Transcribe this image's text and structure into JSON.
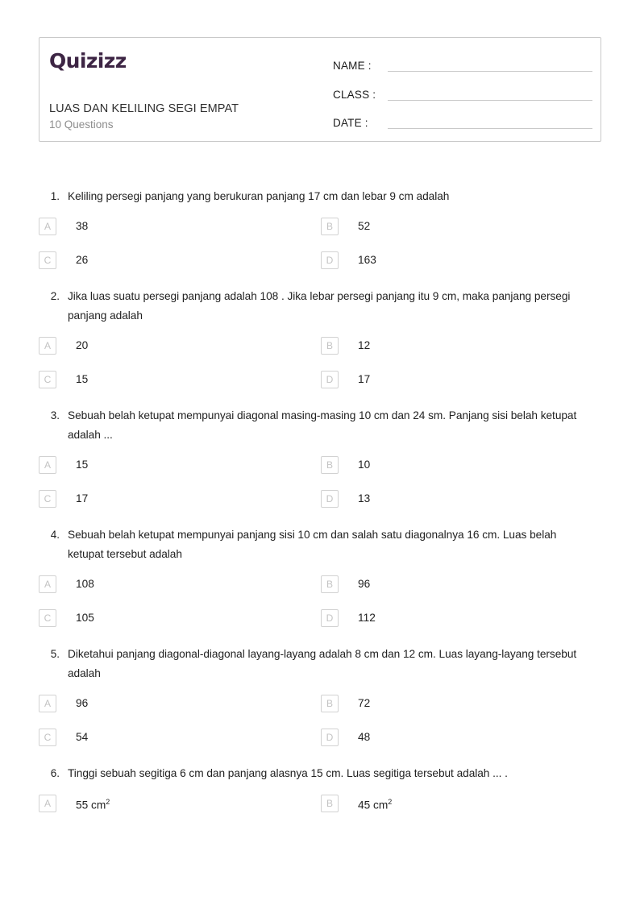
{
  "header": {
    "brand": "Quizizz",
    "title": "LUAS DAN KELILING SEGI EMPAT",
    "question_count": "10 Questions",
    "fields": [
      {
        "label": "NAME :",
        "value": ""
      },
      {
        "label": "CLASS :",
        "value": ""
      },
      {
        "label": "DATE  :",
        "value": ""
      }
    ]
  },
  "colors": {
    "brand_purple": "#3d2544",
    "card_border": "#c9c9c9",
    "option_box_border": "#d2d2d2",
    "option_letter": "#c3c3c3",
    "text": "#222222",
    "muted_text": "#8d8d8d"
  },
  "questions": [
    {
      "number": "1.",
      "text": "Keliling persegi panjang yang berukuran panjang 17 cm dan lebar 9 cm adalah",
      "options": [
        {
          "letter": "A",
          "text": "38"
        },
        {
          "letter": "B",
          "text": "52"
        },
        {
          "letter": "C",
          "text": "26"
        },
        {
          "letter": "D",
          "text": "163"
        }
      ]
    },
    {
      "number": "2.",
      "text": "Jika luas suatu persegi panjang adalah 108 . Jika lebar persegi panjang itu 9 cm, maka panjang persegi panjang adalah",
      "options": [
        {
          "letter": "A",
          "text": "20"
        },
        {
          "letter": "B",
          "text": "12"
        },
        {
          "letter": "C",
          "text": "15"
        },
        {
          "letter": "D",
          "text": "17"
        }
      ]
    },
    {
      "number": "3.",
      "text": "Sebuah belah ketupat mempunyai diagonal masing-masing 10 cm dan 24 sm. Panjang sisi belah ketupat adalah ...",
      "options": [
        {
          "letter": "A",
          "text": "15"
        },
        {
          "letter": "B",
          "text": "10"
        },
        {
          "letter": "C",
          "text": "17"
        },
        {
          "letter": "D",
          "text": "13"
        }
      ]
    },
    {
      "number": "4.",
      "text": "Sebuah belah ketupat mempunyai panjang sisi 10 cm dan salah satu diagonalnya 16 cm. Luas belah ketupat tersebut adalah",
      "options": [
        {
          "letter": "A",
          "text": "108"
        },
        {
          "letter": "B",
          "text": "96"
        },
        {
          "letter": "C",
          "text": "105"
        },
        {
          "letter": "D",
          "text": "112"
        }
      ]
    },
    {
      "number": "5.",
      "text": "Diketahui panjang diagonal-diagonal layang-layang adalah 8 cm dan 12 cm. Luas layang-layang tersebut adalah",
      "options": [
        {
          "letter": "A",
          "text": "96"
        },
        {
          "letter": "B",
          "text": "72"
        },
        {
          "letter": "C",
          "text": "54"
        },
        {
          "letter": "D",
          "text": "48"
        }
      ]
    },
    {
      "number": "6.",
      "text": "Tinggi sebuah segitiga 6 cm dan panjang alasnya 15 cm. Luas segitiga tersebut adalah ... .",
      "options": [
        {
          "letter": "A",
          "text": "55 cm2"
        },
        {
          "letter": "B",
          "text": "45 cm2"
        }
      ]
    }
  ]
}
